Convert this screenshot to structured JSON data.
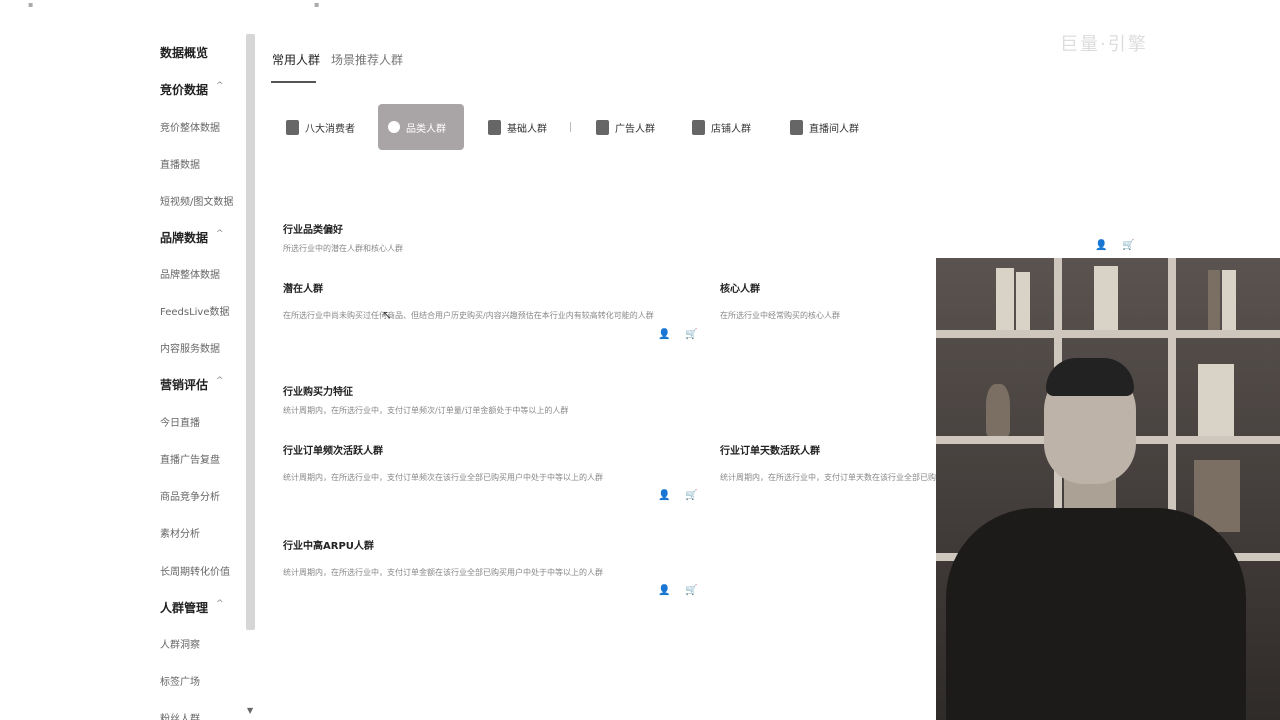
{
  "sidebar": {
    "overview": "数据概览",
    "groups": [
      {
        "label": "竞价数据",
        "caret": "^",
        "items": [
          "竞价整体数据",
          "直播数据",
          "短视频/图文数据"
        ]
      },
      {
        "label": "品牌数据",
        "caret": "^",
        "items": [
          "品牌整体数据",
          "FeedsLive数据",
          "内容服务数据"
        ]
      },
      {
        "label": "营销评估",
        "caret": "^",
        "items": [
          "今日直播",
          "直播广告复盘",
          "商品竞争分析",
          "素材分析",
          "长周期转化价值"
        ]
      },
      {
        "label": "人群管理",
        "caret": "^",
        "items": [
          "人群洞察",
          "标签广场",
          "粉丝人群"
        ]
      }
    ],
    "scroll_arrow": "▼"
  },
  "tabs": [
    {
      "label": "常用人群",
      "active": true
    },
    {
      "label": "场景推荐人群",
      "active": false
    }
  ],
  "categories": [
    {
      "label": "八大消费者",
      "icon": "person-icon",
      "active": false
    },
    {
      "label": "品类人群",
      "icon": "category-icon",
      "active": true
    },
    {
      "label": "基础人群",
      "icon": "user-icon",
      "active": false
    },
    {
      "label": "广告人群",
      "icon": "ad-icon",
      "active": false
    },
    {
      "label": "店铺人群",
      "icon": "store-icon",
      "active": false
    },
    {
      "label": "直播间人群",
      "icon": "live-icon",
      "active": false
    }
  ],
  "sections": {
    "pref": {
      "title": "行业品类偏好",
      "desc": "所选行业中的潜在人群和核心人群"
    },
    "potential": {
      "title": "潜在人群",
      "desc": "在所选行业中尚未购买过任何商品、但结合用户历史购买/内容兴趣预估在本行业内有较高转化可能的人群"
    },
    "core": {
      "title": "核心人群",
      "desc": "在所选行业中经常购买的核心人群"
    },
    "power": {
      "title": "行业购买力特征",
      "desc": "统计周期内，在所选行业中，支付订单频次/订单量/订单金额处于中等以上的人群"
    },
    "freq": {
      "title": "行业订单频次活跃人群",
      "desc": "统计周期内，在所选行业中，支付订单频次在该行业全部已购买用户中处于中等以上的人群"
    },
    "days": {
      "title": "行业订单天数活跃人群",
      "desc": "统计周期内，在所选行业中，支付订单天数在该行业全部已购"
    },
    "arpu": {
      "title": "行业中高ARPU人群",
      "desc": "统计周期内，在所选行业中，支付订单金额在该行业全部已购买用户中处于中等以上的人群"
    }
  },
  "actions": {
    "user_icon": "👤",
    "cart_icon": "🛒"
  },
  "brand_text": "巨量·引擎",
  "colors": {
    "active_category_bg": "#a9a5a6",
    "scrollbar": "#d6d6d6"
  }
}
